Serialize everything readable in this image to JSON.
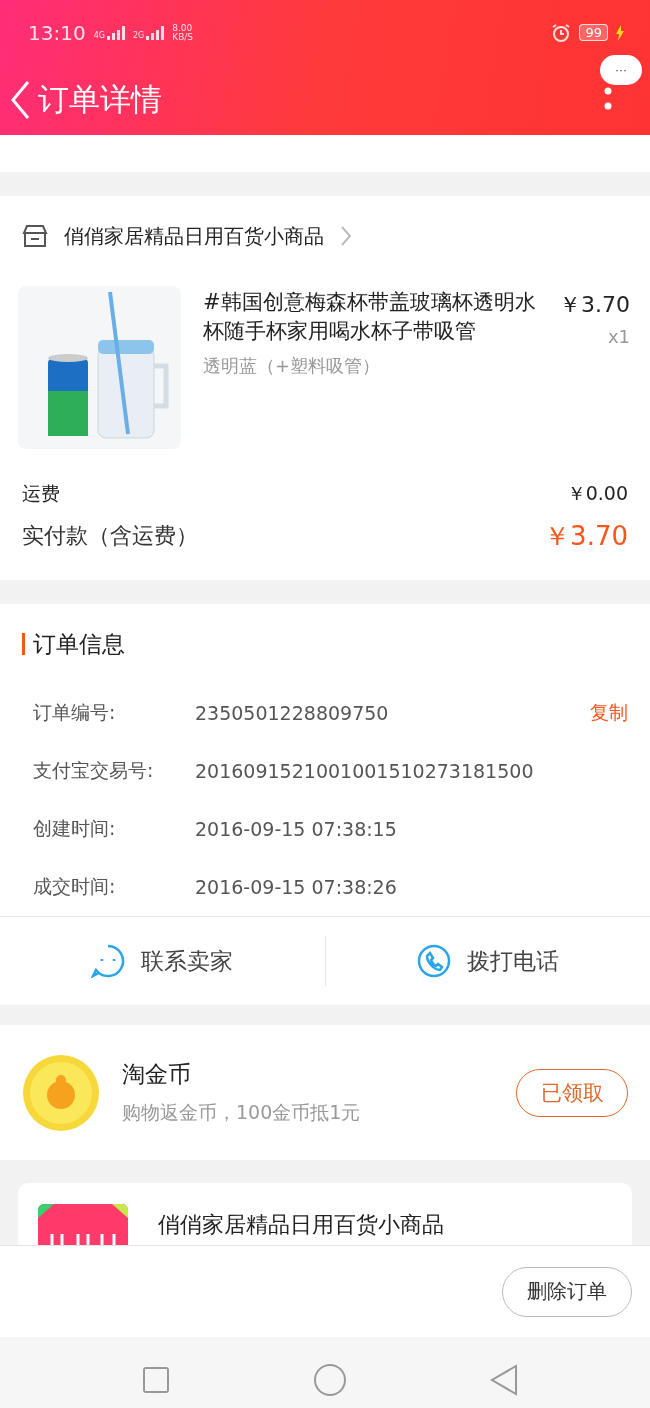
{
  "status_bar": {
    "time": "13:10",
    "network_1": "4G",
    "network_2": "2G",
    "speed": "8.00",
    "speed_unit": "KB/S",
    "battery": "99",
    "charging": true
  },
  "header": {
    "title": "订单详情",
    "more": "···"
  },
  "shop": {
    "name": "俏俏家居精品日用百货小商品"
  },
  "product": {
    "kind": "picture",
    "title": "#韩国创意梅森杯带盖玻璃杯透明水杯随手杯家用喝水杯子带吸管",
    "sku": "透明蓝（+塑料吸管）",
    "price": "￥3.70",
    "quantity": "x1"
  },
  "fees": [
    {
      "label": "运费",
      "value": "￥0.00",
      "kind": "plain"
    },
    {
      "label": "实付款（含运费）",
      "value": "￥3.70",
      "kind": "total"
    }
  ],
  "order_info": {
    "title": "订单信息",
    "copy": "复制",
    "rows": [
      {
        "label": "订单编号:",
        "value": "2350501228809750"
      },
      {
        "label": "支付宝交易号:",
        "value": "2016091521001001510273181500"
      },
      {
        "label": "创建时间:",
        "value": "2016-09-15 07:38:15"
      },
      {
        "label": "成交时间:",
        "value": "2016-09-15 07:38:26"
      }
    ]
  },
  "actions": [
    {
      "label": "联系卖家",
      "kind": "chat"
    },
    {
      "label": "拨打电话",
      "kind": "phone"
    }
  ],
  "coins": {
    "title": "淘金币",
    "subtitle": "购物返金币，100金币抵1元",
    "button": "已领取"
  },
  "shop_card": {
    "name": "俏俏家居精品日用百货小商品"
  },
  "bottom_bar": {
    "button": "删除订单"
  }
}
